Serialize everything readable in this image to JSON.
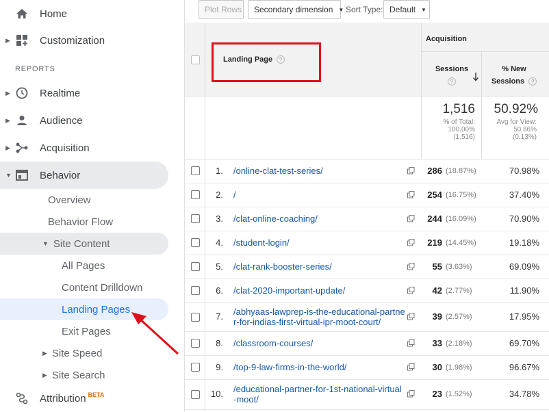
{
  "sidebar": {
    "home": "Home",
    "customization": "Customization",
    "reports_header": "REPORTS",
    "realtime": "Realtime",
    "audience": "Audience",
    "acquisition": "Acquisition",
    "behavior": "Behavior",
    "overview": "Overview",
    "behavior_flow": "Behavior Flow",
    "site_content": "Site Content",
    "all_pages": "All Pages",
    "content_drilldown": "Content Drilldown",
    "landing_pages": "Landing Pages",
    "exit_pages": "Exit Pages",
    "site_speed": "Site Speed",
    "site_search": "Site Search",
    "attribution": "Attribution",
    "beta": "BETA"
  },
  "toolbar": {
    "plot_rows": "Plot Rows",
    "secondary_dimension": "Secondary dimension",
    "sort_type_label": "Sort Type:",
    "sort_type_value": "Default"
  },
  "table": {
    "landing_page_header": "Landing Page",
    "help_glyph": "?",
    "acquisition_header": "Acquisition",
    "sessions_header": "Sessions",
    "new_sessions_header_1": "% New",
    "new_sessions_header_2": "Sessions",
    "summary": {
      "sessions_total": "1,516",
      "sessions_sub_1": "% of Total:",
      "sessions_sub_2": "100.00%",
      "sessions_sub_3": "(1,516)",
      "new_total": "50.92%",
      "new_sub_1": "Avg for View:",
      "new_sub_2": "50.86%",
      "new_sub_3": "(0.13%)"
    },
    "rows": [
      {
        "num": "1.",
        "page": "/online-clat-test-series/",
        "page2": "",
        "sessions": "286",
        "pct": "(18.87%)",
        "new": "70.98%"
      },
      {
        "num": "2.",
        "page": "/",
        "page2": "",
        "sessions": "254",
        "pct": "(16.75%)",
        "new": "37.40%"
      },
      {
        "num": "3.",
        "page": "/clat-online-coaching/",
        "page2": "",
        "sessions": "244",
        "pct": "(16.09%)",
        "new": "70.90%"
      },
      {
        "num": "4.",
        "page": "/student-login/",
        "page2": "",
        "sessions": "219",
        "pct": "(14.45%)",
        "new": "19.18%"
      },
      {
        "num": "5.",
        "page": "/clat-rank-booster-series/",
        "page2": "",
        "sessions": "55",
        "pct": "(3.63%)",
        "new": "69.09%"
      },
      {
        "num": "6.",
        "page": "/clat-2020-important-update/",
        "page2": "",
        "sessions": "42",
        "pct": "(2.77%)",
        "new": "11.90%"
      },
      {
        "num": "7.",
        "page": "/abhyaas-lawprep-is-the-educational-partne",
        "page2": "r-for-indias-first-virtual-ipr-moot-court/",
        "sessions": "39",
        "pct": "(2.57%)",
        "new": "17.95%"
      },
      {
        "num": "8.",
        "page": "/classroom-courses/",
        "page2": "",
        "sessions": "33",
        "pct": "(2.18%)",
        "new": "69.70%"
      },
      {
        "num": "9.",
        "page": "/top-9-law-firms-in-the-world/",
        "page2": "",
        "sessions": "30",
        "pct": "(1.98%)",
        "new": "96.67%"
      },
      {
        "num": "10.",
        "page": "/educational-partner-for-1st-national-virtual",
        "page2": "-moot/",
        "sessions": "23",
        "pct": "(1.52%)",
        "new": "34.78%"
      }
    ]
  },
  "colors": {
    "accent": "#1a73e8",
    "highlight_red": "#e0101a",
    "link": "#1558a8"
  }
}
